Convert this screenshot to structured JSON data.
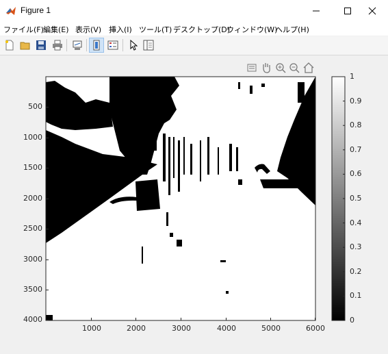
{
  "window": {
    "title": "Figure 1",
    "icon": "matlab-icon",
    "controls": [
      "minimize-icon",
      "maximize-icon",
      "close-icon"
    ]
  },
  "menu": {
    "items": [
      "ファイル(F)",
      "編集(E)",
      "表示(V)",
      "挿入(I)",
      "ツール(T)",
      "デスクトップ(D)",
      "ウィンドウ(W)",
      "ヘルプ(H)"
    ]
  },
  "toolbar": {
    "buttons": [
      "new-figure-icon",
      "open-file-icon",
      "save-icon",
      "print-icon",
      "link-plot-icon",
      "insert-colorbar-icon",
      "insert-legend-icon",
      "edit-plot-icon",
      "property-inspector-icon"
    ],
    "active": "insert-colorbar-icon"
  },
  "axes_toolbar": {
    "buttons": [
      "datatips-icon",
      "pan-icon",
      "zoom-in-icon",
      "zoom-out-icon",
      "home-icon"
    ]
  },
  "image_axes": {
    "x_ticks": [
      "1000",
      "2000",
      "3000",
      "4000",
      "5000",
      "6000"
    ],
    "y_ticks": [
      "500",
      "1000",
      "1500",
      "2000",
      "2500",
      "3000",
      "3500",
      "4000"
    ],
    "xlim": [
      0,
      6000
    ],
    "ylim": [
      0,
      4000
    ],
    "content": "binary image (black and white)"
  },
  "colorbar": {
    "ticks": [
      "0",
      "0.1",
      "0.2",
      "0.3",
      "0.4",
      "0.5",
      "0.6",
      "0.7",
      "0.8",
      "0.9",
      "1"
    ],
    "range": [
      0,
      1
    ],
    "colormap": "gray"
  },
  "colors": {
    "matlab_orange": "#d9541a",
    "active_blue": "#cfe3f7"
  }
}
